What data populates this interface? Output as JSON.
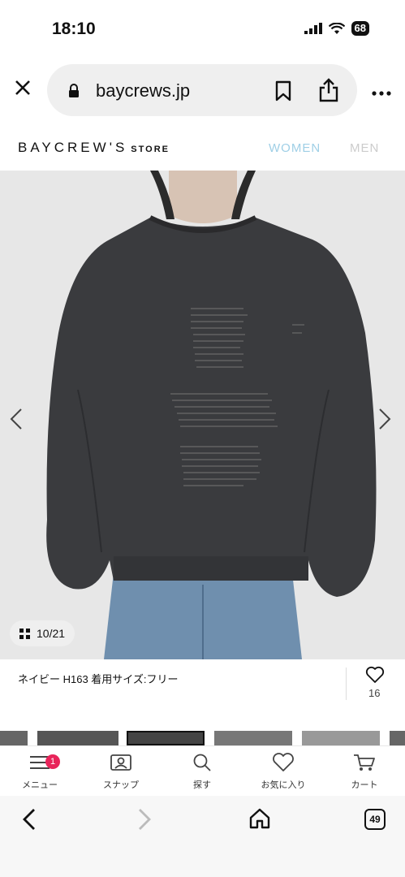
{
  "status_bar": {
    "time": "18:10",
    "battery": "68"
  },
  "browser": {
    "url": "baycrews.jp",
    "tab_count": "49"
  },
  "site_header": {
    "logo": "BAYCREW'S",
    "logo_store": "STORE",
    "nav": [
      "WOMEN",
      "MEN"
    ],
    "colors": {
      "active_nav": "#9fcfe6",
      "inactive_nav": "#cccccc"
    }
  },
  "gallery": {
    "counter": "10/21"
  },
  "product": {
    "caption": "ネイビー H163 着用サイズ:フリー",
    "like_count": "16"
  },
  "bottom_nav": {
    "items": [
      {
        "label": "メニュー",
        "icon": "menu-icon",
        "badge": "1"
      },
      {
        "label": "スナップ",
        "icon": "snap-icon"
      },
      {
        "label": "探す",
        "icon": "search-icon"
      },
      {
        "label": "お気に入り",
        "icon": "heart-icon"
      },
      {
        "label": "カート",
        "icon": "cart-icon"
      }
    ],
    "badge_color": "#e8245a"
  }
}
